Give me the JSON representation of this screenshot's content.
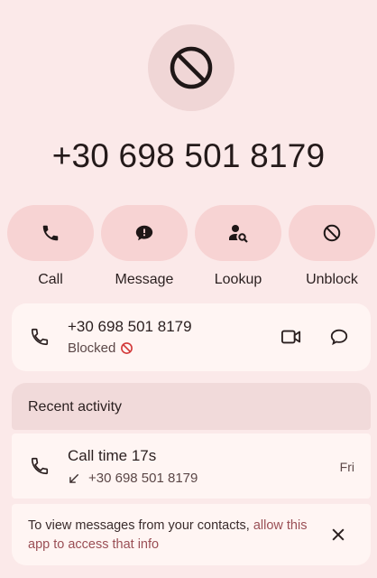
{
  "contact": {
    "number": "+30 698 501 8179",
    "status": "Blocked"
  },
  "actions": [
    {
      "label": "Call",
      "icon": "phone-icon"
    },
    {
      "label": "Message",
      "icon": "message-icon"
    },
    {
      "label": "Lookup",
      "icon": "person-search-icon"
    },
    {
      "label": "Unblock",
      "icon": "block-icon"
    }
  ],
  "recent": {
    "header": "Recent activity",
    "call": {
      "title": "Call time 17s",
      "number": "+30 698 501 8179",
      "day": "Fri",
      "direction_icon": "incoming-arrow-icon"
    }
  },
  "info": {
    "text": "To view messages from your contacts, ",
    "link": "allow this app to access that info"
  },
  "colors": {
    "background": "#fbe9e9",
    "button": "#f7d3d3",
    "card": "#fff5f3",
    "blocked_red": "#d33a3a",
    "link": "#9a4f55"
  }
}
